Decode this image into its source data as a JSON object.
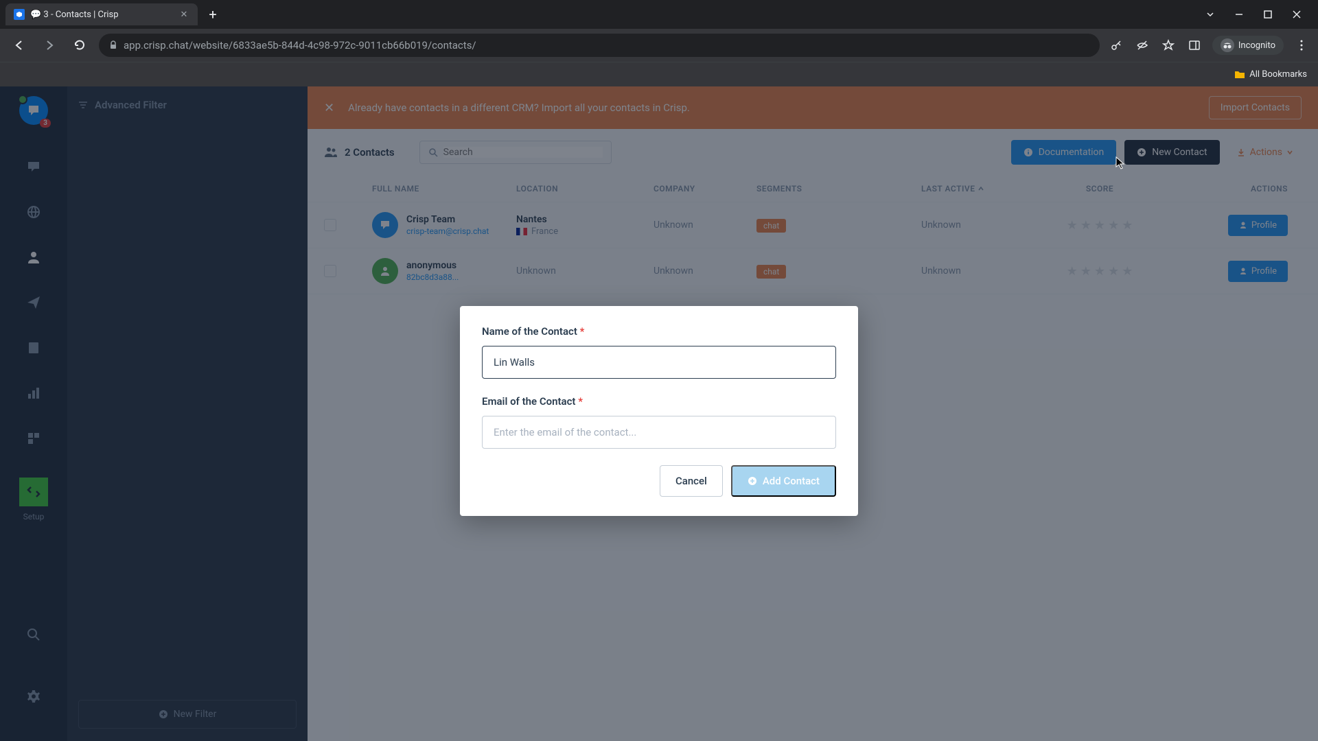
{
  "browser": {
    "tab_title": "💬 3 - Contacts | Crisp",
    "url": "app.crisp.chat/website/6833ae5b-844d-4c98-972c-9011cb66b019/contacts/",
    "incognito_label": "Incognito",
    "all_bookmarks": "All Bookmarks"
  },
  "rail": {
    "badge": "3",
    "setup_label": "Setup"
  },
  "sidebar": {
    "advanced_filter": "Advanced Filter",
    "new_filter": "New Filter"
  },
  "banner": {
    "text": "Already have contacts in a different CRM? Import all your contacts in Crisp.",
    "import_btn": "Import Contacts"
  },
  "toolbar": {
    "count": "2 Contacts",
    "search_placeholder": "Search",
    "documentation": "Documentation",
    "new_contact": "New Contact",
    "actions": "Actions"
  },
  "table": {
    "headers": {
      "full_name": "FULL NAME",
      "location": "LOCATION",
      "company": "COMPANY",
      "segments": "SEGMENTS",
      "last_active": "LAST ACTIVE",
      "score": "SCORE",
      "actions": "ACTIONS"
    },
    "rows": [
      {
        "name": "Crisp Team",
        "email": "crisp-team@crisp.chat",
        "location": "Nantes",
        "country": "France",
        "company": "Unknown",
        "segment": "chat",
        "last_active": "Unknown",
        "profile_btn": "Profile"
      },
      {
        "name": "anonymous",
        "email": "82bc8d3a88...",
        "location": "Unknown",
        "country": "",
        "company": "Unknown",
        "segment": "chat",
        "last_active": "Unknown",
        "profile_btn": "Profile"
      }
    ]
  },
  "modal": {
    "name_label": "Name of the Contact",
    "email_label": "Email of the Contact",
    "name_value": "Lin Walls",
    "email_placeholder": "Enter the email of the contact...",
    "cancel": "Cancel",
    "add": "Add Contact"
  }
}
